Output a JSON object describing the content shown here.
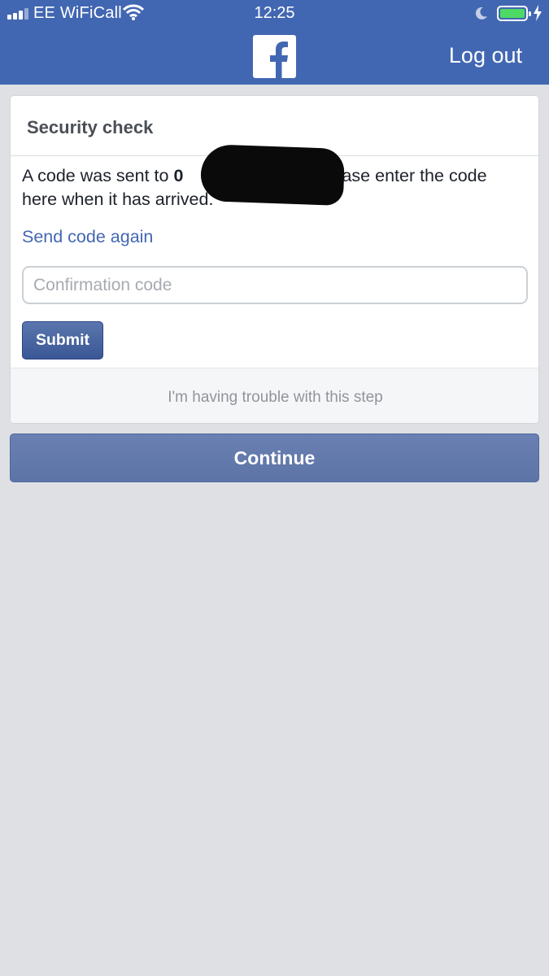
{
  "status_bar": {
    "carrier": "EE WiFiCall",
    "time": "12:25",
    "battery_color": "#4cd964"
  },
  "header": {
    "logo_icon": "facebook-f-logo",
    "logout_label": "Log out",
    "bg_color": "#4267b2"
  },
  "security_card": {
    "title": "Security check",
    "message_prefix": "A code was sent to ",
    "message_number_visible": "0",
    "message_suffix": " Please enter the code here when it has arrived.",
    "send_again_label": "Send code again",
    "code_input": {
      "value": "",
      "placeholder": "Confirmation code"
    },
    "submit_label": "Submit",
    "trouble_label": "I'm having trouble with this step"
  },
  "continue_label": "Continue"
}
